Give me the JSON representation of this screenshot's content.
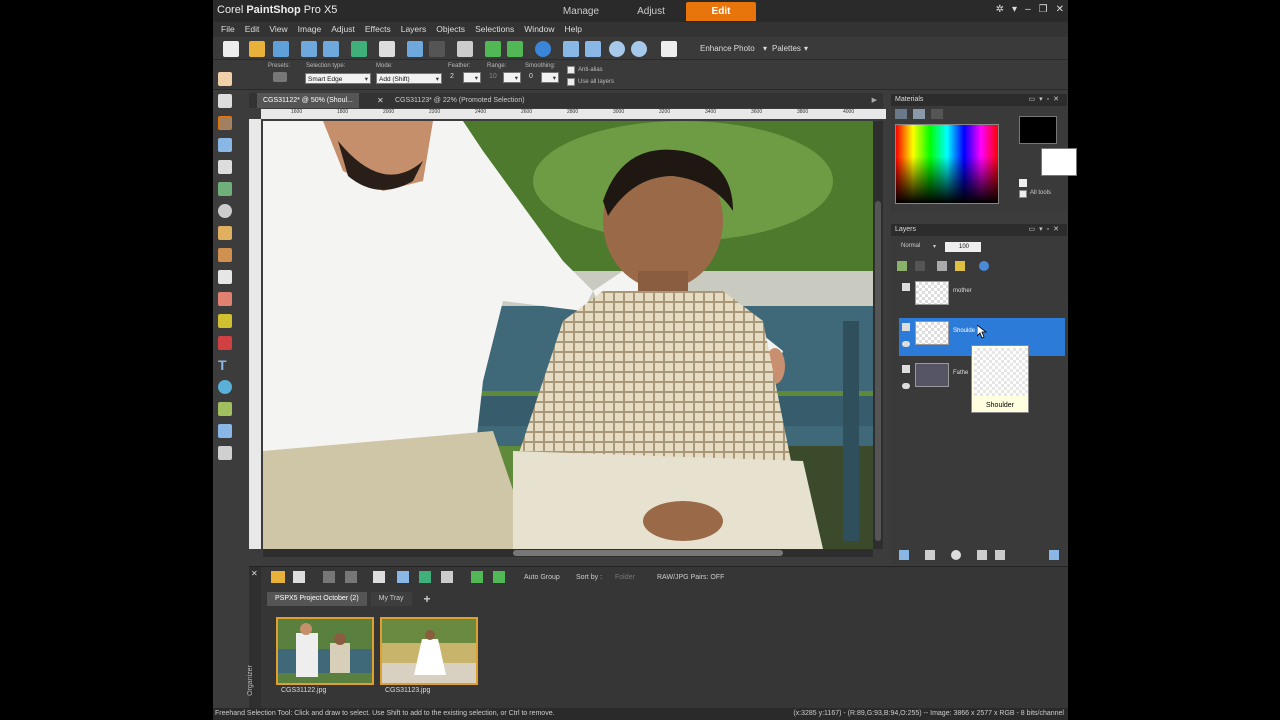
{
  "app": {
    "title_prefix": "Corel ",
    "title_bold": "PaintShop",
    "title_suffix": " Pro X5",
    "mode_tabs": [
      "Manage",
      "Adjust",
      "Edit"
    ],
    "active_mode": "Edit"
  },
  "menu": [
    "File",
    "Edit",
    "View",
    "Image",
    "Adjust",
    "Effects",
    "Layers",
    "Objects",
    "Selections",
    "Window",
    "Help"
  ],
  "toolbar": {
    "enhance_photo": "Enhance Photo",
    "palettes": "Palettes"
  },
  "options": {
    "presets_label": "Presets:",
    "selection_type_label": "Selection type:",
    "selection_type_value": "Smart Edge",
    "mode_label": "Mode:",
    "mode_value": "Add (Shift)",
    "feather_label": "Feather:",
    "feather_value": "2",
    "range_label": "Range:",
    "range_value": "10",
    "smoothing_label": "Smoothing:",
    "smoothing_value": "0",
    "antialias_label": "Anti-alias",
    "use_all_layers_label": "Use all layers"
  },
  "doc_tabs": [
    {
      "label": "CGS31122* @  50% (Shoul..."
    },
    {
      "label": "CGS31123* @  22% (Promoted Selection)"
    }
  ],
  "ruler": [
    "1600",
    "1800",
    "2000",
    "2200",
    "2400",
    "2600",
    "2800",
    "3000",
    "3200",
    "3400",
    "3600",
    "3800",
    "4000",
    "4200"
  ],
  "materials": {
    "title": "Materials",
    "all_tools": "All tools"
  },
  "layers": {
    "title": "Layers",
    "blend_mode": "Normal",
    "opacity": "100",
    "rows": [
      {
        "name": "mother"
      },
      {
        "name": "Shoulde"
      },
      {
        "name": "Fathe"
      }
    ],
    "tooltip": "Shoulder"
  },
  "organizer": {
    "side_label": "Organizer",
    "auto_group": "Auto Group",
    "sort_by": "Sort by :",
    "sort_value": "Folder",
    "raw_pairs": "RAW/JPG Pairs: OFF",
    "tabs": [
      "PSPX5 Project October (2)",
      "My Tray"
    ],
    "add_tab": "+",
    "photos": [
      {
        "label": "CGS31122.jpg"
      },
      {
        "label": "CGS31123.jpg"
      }
    ]
  },
  "status": {
    "left": "Freehand Selection Tool: Click and draw to select. Use Shift to add to the existing selection, or Ctrl to remove.",
    "right": "(x:3285 y:1167) - (R:89,G:93,B:94,O:255) -- Image:  3866 x 2577 x RGB - 8 bits/channel"
  },
  "colors": {
    "accent": "#e8740c",
    "layer_selected": "#2c7bd8"
  }
}
